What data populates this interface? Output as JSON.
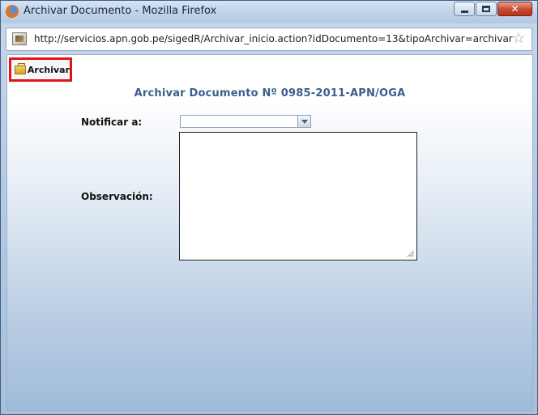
{
  "window": {
    "title": "Archivar Documento - Mozilla Firefox",
    "buttons": {
      "minimize": "minimize-icon",
      "maximize": "maximize-icon",
      "close": "close-icon"
    }
  },
  "urlbar": {
    "url": "http://servicios.apn.gob.pe/sigedR/Archivar_inicio.action?idDocumento=13&tipoArchivar=archivar",
    "star_icon": "star-icon"
  },
  "toolbar": {
    "archive_label": "Archivar",
    "archive_icon": "folder-archive-icon",
    "highlight_color": "#e0141a"
  },
  "form": {
    "title": "Archivar Documento Nº 0985-2011-APN/OGA",
    "notify_label": "Notificar a:",
    "notify_value": "",
    "observation_label": "Observación:",
    "observation_value": ""
  },
  "colors": {
    "title_color": "#3b5f8b"
  }
}
